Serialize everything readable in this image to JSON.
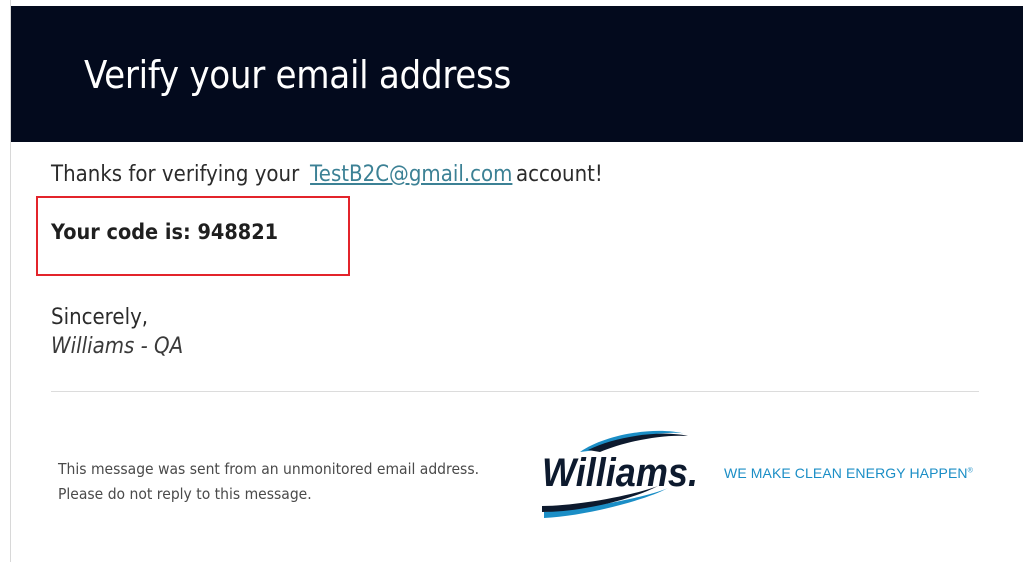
{
  "header": {
    "title": "Verify your email address"
  },
  "body": {
    "thanks_prefix": "Thanks for verifying your",
    "email": "TestB2C@gmail.com",
    "thanks_suffix": "account!",
    "code_text": "Your code is: 948821",
    "sincerely": "Sincerely,",
    "signature": "Williams - QA"
  },
  "footer": {
    "note_line1": "This message was sent from an unmonitored email address.",
    "note_line2": "Please do not reply to this message.",
    "logo_text": "Williams.",
    "tagline": "WE MAKE CLEAN ENERGY HAPPEN",
    "tagline_mark": "®"
  },
  "colors": {
    "header_bg": "#030a1d",
    "link": "#3c8195",
    "highlight_border": "#e3242b",
    "brand_blue": "#1b8ec6",
    "brand_dark": "#0d1a2e"
  },
  "icons": {
    "logo": "williams-swoosh-logo"
  }
}
